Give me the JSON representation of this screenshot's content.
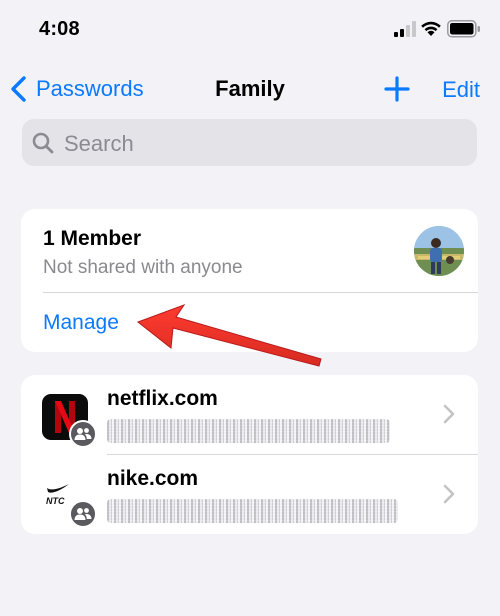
{
  "status_bar": {
    "time": "4:08"
  },
  "nav": {
    "back_label": "Passwords",
    "title": "Family",
    "edit_label": "Edit"
  },
  "search": {
    "placeholder": "Search"
  },
  "group": {
    "member_count": "1 Member",
    "sharing_status": "Not shared with anyone",
    "manage_label": "Manage"
  },
  "passwords": [
    {
      "site": "netflix.com",
      "icon": "netflix-logo",
      "shared": true
    },
    {
      "site": "nike.com",
      "icon": "nike-ntc-logo",
      "shared": true
    }
  ],
  "colors": {
    "accent": "#0a7aff",
    "annotation_arrow": "#e53935",
    "background": "#f2f2f7"
  }
}
